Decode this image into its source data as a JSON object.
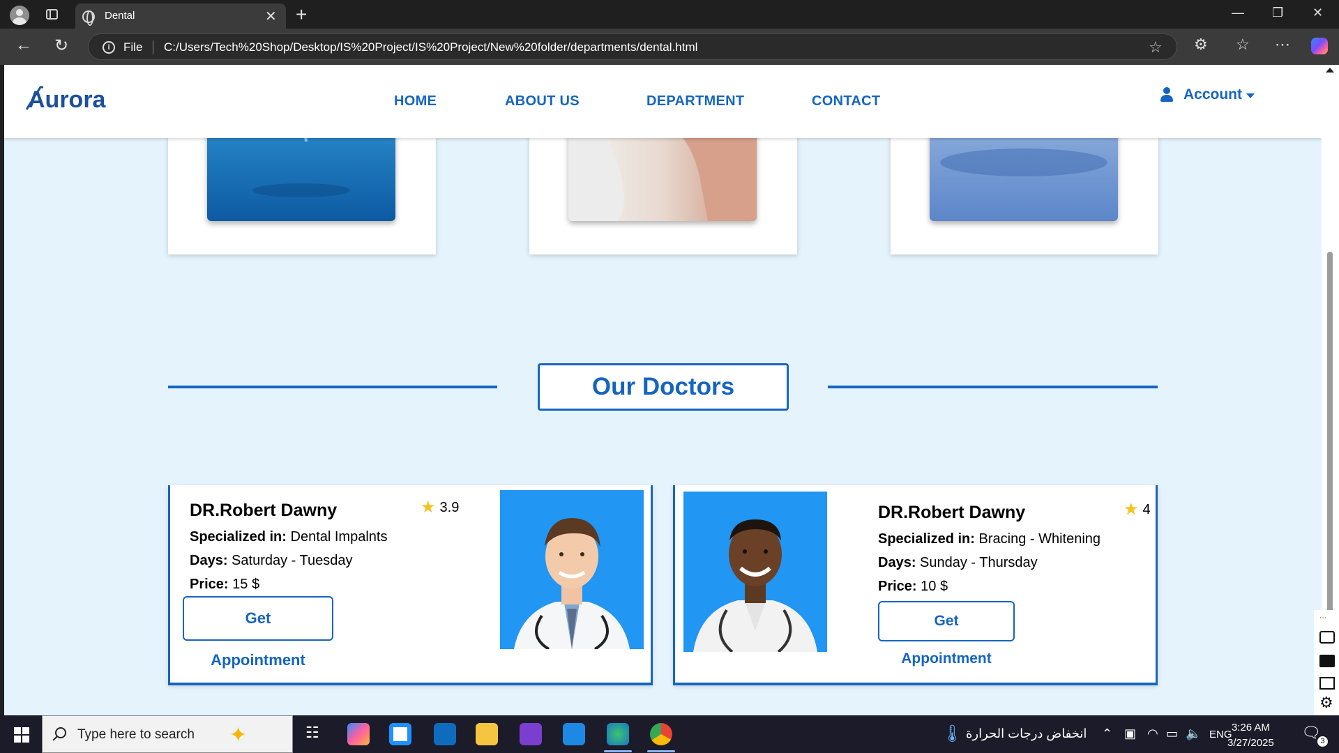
{
  "browser": {
    "tab_title": "Dental",
    "tab_close": "✕",
    "new_tab": "+",
    "file_label": "File",
    "url": "C:/Users/Tech%20Shop/Desktop/IS%20Project/IS%20Project/New%20folder/departments/dental.html",
    "window_controls": [
      "—",
      "❐",
      "✕"
    ]
  },
  "site": {
    "logo_text": "Aurora",
    "nav": [
      "HOME",
      "ABOUT US",
      "DEPARTMENT",
      "CONTACT"
    ],
    "account_label": "Account"
  },
  "section": {
    "title": "Our Doctors"
  },
  "doctors": [
    {
      "name": "DR.Robert Dawny",
      "rating": "3.9",
      "specialized_label": "Specialized in:",
      "specialized": "Dental Impalnts",
      "days_label": "Days:",
      "days": "Saturday - Tuesday",
      "price_label": "Price:",
      "price": "15 $",
      "button": "Get Appointment"
    },
    {
      "name": "DR.Robert Dawny",
      "rating": "4",
      "specialized_label": "Specialized in:",
      "specialized": "Bracing - Whitening",
      "days_label": "Days:",
      "days": "Sunday - Thursday",
      "price_label": "Price:",
      "price": "10 $",
      "button": "Get Appointment"
    }
  ],
  "taskbar": {
    "search_placeholder": "Type here to search",
    "weather_text": "انخفاض درجات الحرارة",
    "language": "ENG",
    "time": "3:26 AM",
    "date": "3/27/2025",
    "notification_count": "3"
  },
  "colors": {
    "brand_blue": "#1565c0",
    "page_background": "#e4f3fc",
    "star": "#f9c21a"
  }
}
